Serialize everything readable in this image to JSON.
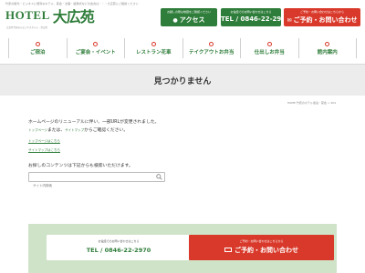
{
  "header": {
    "tagline": "竹原の観光・ビジネスに便利なホテル、宴会・法事・結婚式などの会食は・・・大広苑にご相談ください",
    "logo_hotel": "HOTEL",
    "logo_name": "大広苑",
    "logo_sub": "広島県竹原市のビジネスホテル・宴会場",
    "access": {
      "note": "お越しの際は地図をご確認ください",
      "label": "アクセス"
    },
    "tel": {
      "note": "お電話でのお問い合わせはこちら",
      "label": "TEL / 0846-22-2970"
    },
    "reserve": {
      "note": "ご予約・お問い合わせはこちらから",
      "label": "ご予約・お問い合わせ"
    }
  },
  "nav": {
    "items": [
      {
        "label": "ご宿泊"
      },
      {
        "label": "ご宴会・イベント"
      },
      {
        "label": "レストラン花車"
      },
      {
        "label": "テイクアウトお弁当"
      },
      {
        "label": "仕出しお弁当"
      },
      {
        "label": "館内案内"
      }
    ]
  },
  "page": {
    "title": "見つかりません",
    "breadcrumb": "HOME 竹原のホテル宿泊・宴会 > 404"
  },
  "content": {
    "line1": "ホームページのリニューアルに伴い、一部URLが変更されました。",
    "line2_link_a": "トップページ",
    "line2_mid": "または、",
    "line2_link_b": "サイトマップ",
    "line2_end": "からご確認ください。",
    "link1": "トップページはこちら",
    "link2": "サイトマップはこちら",
    "search_text": "お探しのコンテンツは下記からも検索いただけます。",
    "search_placeholder": "サイト内検索"
  },
  "footer": {
    "tel_note": "お電話でのお問い合わせはこちら",
    "tel_label": "TEL / 0846-22-2970",
    "reserve_note": "ご予約・お問い合わせはこちらから",
    "reserve_label": "ご予約・お問い合わせ"
  },
  "colors": {
    "brand_green": "#2f7d3a",
    "accent_red": "#d9392a",
    "footer_bg": "#cfe3c8"
  }
}
